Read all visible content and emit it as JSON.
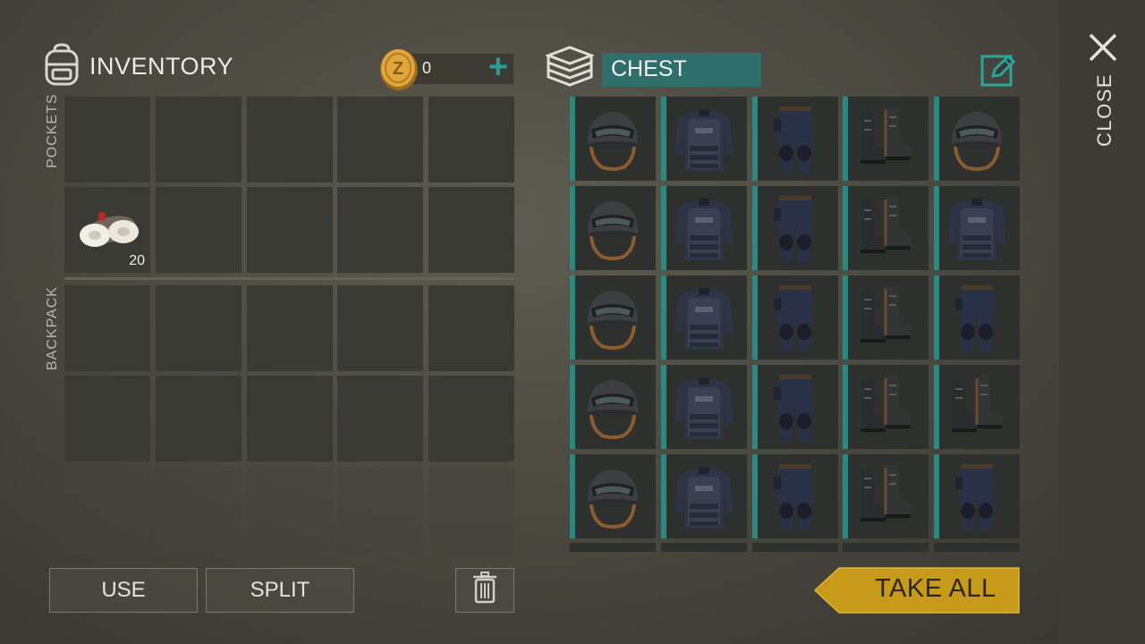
{
  "inventory": {
    "title": "INVENTORY",
    "coins": "0",
    "pockets_label": "POCKETS",
    "backpack_label": "BACKPACK",
    "bandage_qty": "20"
  },
  "chest": {
    "title": "CHEST",
    "take_all_label": "TAKE ALL",
    "grid": [
      [
        "helmet",
        "vest",
        "pants",
        "boots",
        "helmet"
      ],
      [
        "helmet",
        "vest",
        "pants",
        "boots",
        "vest"
      ],
      [
        "helmet",
        "vest",
        "pants",
        "boots",
        "pants"
      ],
      [
        "helmet",
        "vest",
        "pants",
        "boots",
        "boots"
      ],
      [
        "helmet",
        "vest",
        "pants",
        "boots",
        "pants"
      ]
    ]
  },
  "buttons": {
    "use_label": "USE",
    "split_label": "SPLIT"
  },
  "close": {
    "label": "CLOSE"
  },
  "colors": {
    "accent": "#2e9c93",
    "chest_title_bg": "#2f6f6b",
    "take_all_bg": "#c79a1a"
  },
  "icons": {
    "backpack": "backpack-icon",
    "coin": "coin-icon",
    "chest": "chest-stack-icon",
    "edit": "edit-pencil-icon",
    "trash": "trash-icon",
    "close": "close-icon"
  }
}
